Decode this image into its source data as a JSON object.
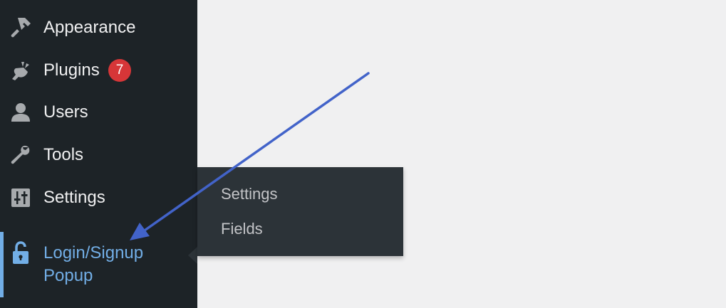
{
  "sidebar": {
    "items": [
      {
        "label": "Appearance",
        "icon": "paintbrush-icon"
      },
      {
        "label": "Plugins",
        "icon": "plugin-icon",
        "badge": "7"
      },
      {
        "label": "Users",
        "icon": "users-icon"
      },
      {
        "label": "Tools",
        "icon": "wrench-icon"
      },
      {
        "label": "Settings",
        "icon": "settings-sliders-icon"
      }
    ],
    "active": {
      "label": "Login/Signup Popup",
      "icon": "unlock-icon"
    }
  },
  "flyout": {
    "items": [
      {
        "label": "Settings"
      },
      {
        "label": "Fields"
      }
    ]
  },
  "colors": {
    "sidebar_bg": "#1d2327",
    "flyout_bg": "#2c3338",
    "accent": "#72aee6",
    "badge": "#d63638",
    "annotation_arrow": "#4263c9"
  }
}
